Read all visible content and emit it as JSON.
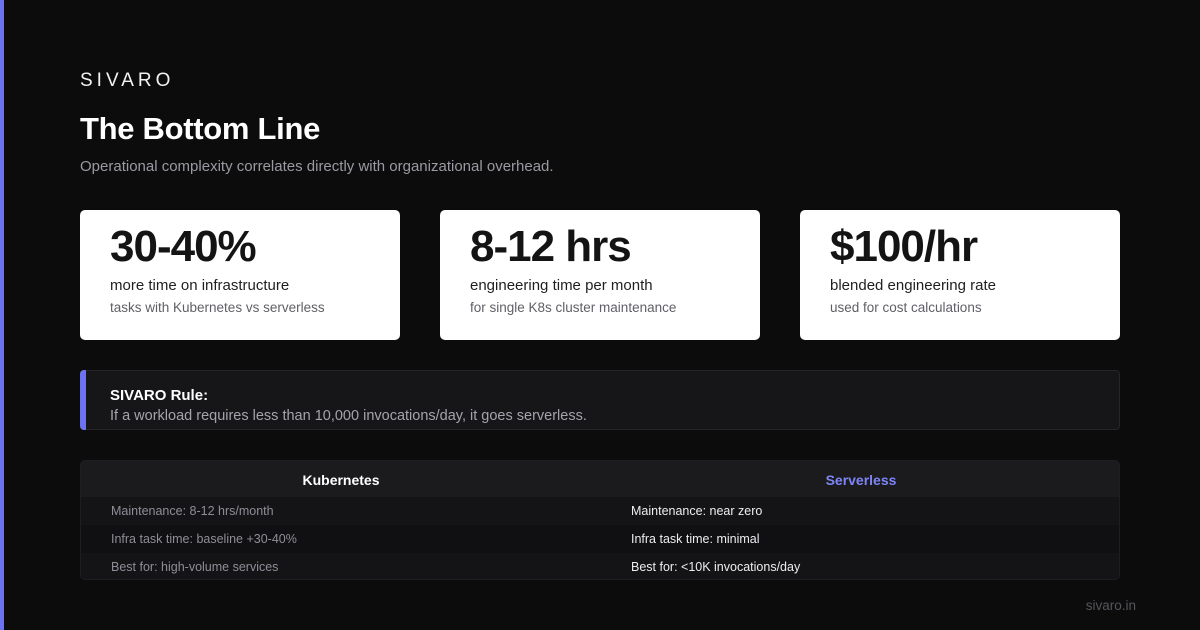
{
  "brand": "SIVARO",
  "title": "The Bottom Line",
  "subtitle": "Operational complexity correlates directly with organizational overhead.",
  "stats": [
    {
      "value": "30-40%",
      "line1": "more time on infrastructure",
      "line2": "tasks with Kubernetes vs serverless"
    },
    {
      "value": "8-12 hrs",
      "line1": "engineering time per month",
      "line2": "for single K8s cluster maintenance"
    },
    {
      "value": "$100/hr",
      "line1": "blended engineering rate",
      "line2": "used for cost calculations"
    }
  ],
  "rule": {
    "title": "SIVARO Rule:",
    "text": "If a workload requires less than 10,000 invocations/day, it goes serverless."
  },
  "comparison": {
    "kubernetes": {
      "heading": "Kubernetes",
      "rows": [
        "Maintenance: 8-12 hrs/month",
        "Infra task time: baseline +30-40%",
        "Best for: high-volume services"
      ]
    },
    "serverless": {
      "heading": "Serverless",
      "rows": [
        "Maintenance: near zero",
        "Infra task time: minimal",
        "Best for: <10K invocations/day"
      ]
    }
  },
  "footer": "sivaro.in",
  "colors": {
    "accent": "#6c72f0",
    "serverless_heading": "#7f85f5",
    "background": "#0c0c0d"
  }
}
